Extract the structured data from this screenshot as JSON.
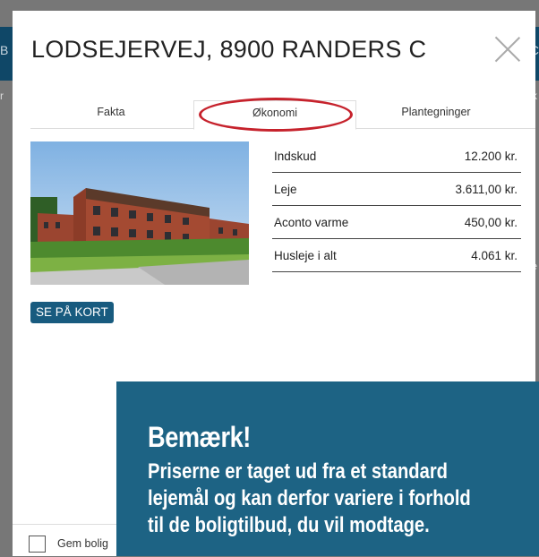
{
  "background": {
    "left_text": "B",
    "right_text": "C",
    "left_mark": "r",
    "right_mark_1": "k",
    "right_mark_2": "e"
  },
  "modal": {
    "title": "LODSEJERVEJ, 8900 RANDERS C",
    "tabs": [
      {
        "label": "Fakta",
        "active": false
      },
      {
        "label": "Økonomi",
        "active": true
      },
      {
        "label": "Plantegninger",
        "active": false
      }
    ],
    "highlight_color": "#c6222c",
    "finance": [
      {
        "label": "Indskud",
        "value": "12.200 kr."
      },
      {
        "label": "Leje",
        "value": "3.611,00 kr."
      },
      {
        "label": "Aconto varme",
        "value": "450,00 kr."
      },
      {
        "label": "Husleje i alt",
        "value": "4.061 kr."
      }
    ],
    "map_button": "SE PÅ KORT",
    "save_label": "Gem bolig",
    "save_checked": false
  },
  "note": {
    "title": "Bemærk!",
    "lines": [
      "Priserne er taget ud fra et standard",
      "lejemål og kan derfor variere i forhold",
      "til de boligtilbud, du vil modtage."
    ],
    "color": "#1d6384"
  }
}
